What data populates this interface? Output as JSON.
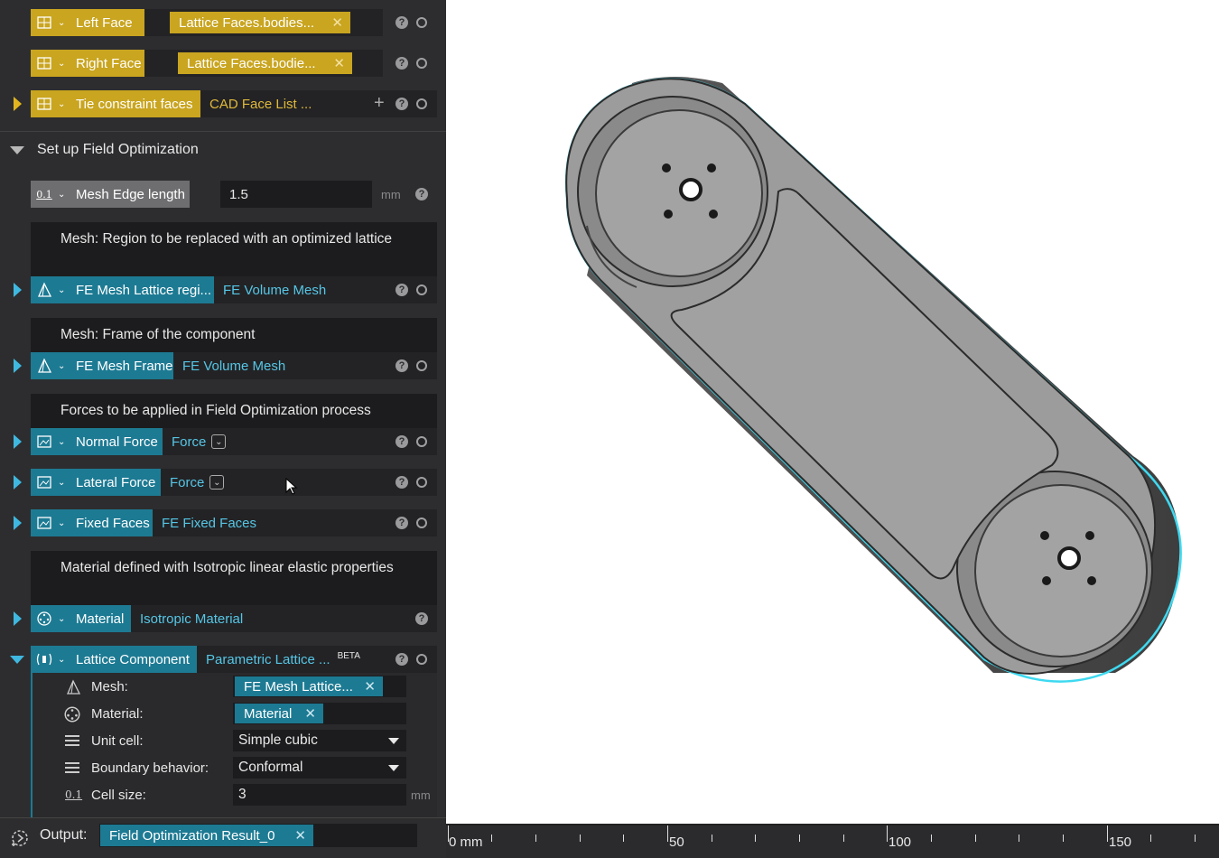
{
  "rows": {
    "left_face": {
      "label": "Left Face",
      "value": "Lattice Faces.bodies..."
    },
    "right_face": {
      "label": "Right Face",
      "value": "Lattice Faces.bodie..."
    },
    "tie": {
      "label": "Tie constraint faces",
      "value": "CAD Face List ..."
    }
  },
  "section": {
    "title": "Set up Field Optimization"
  },
  "mesh_edge": {
    "label": "Mesh Edge length",
    "value": "1.5",
    "unit": "mm",
    "icon_text": "0.1"
  },
  "comments": {
    "region": "Mesh: Region to be replaced with an optimized lattice",
    "frame": "Mesh: Frame of the component",
    "forces": "Forces to be applied in Field Optimization process",
    "material": "Material defined with Isotropic linear elastic properties"
  },
  "fe_lattice": {
    "label": "FE Mesh Lattice regi...",
    "value": "FE Volume Mesh"
  },
  "fe_frame": {
    "label": "FE Mesh Frame",
    "value": "FE Volume Mesh"
  },
  "normal_force": {
    "label": "Normal Force",
    "value": "Force"
  },
  "lateral_force": {
    "label": "Lateral Force",
    "value": "Force"
  },
  "fixed_faces": {
    "label": "Fixed Faces",
    "value": "FE Fixed Faces"
  },
  "material_row": {
    "label": "Material",
    "value": "Isotropic Material"
  },
  "lattice": {
    "label": "Lattice Component",
    "value": "Parametric Lattice ...",
    "badge": "BETA",
    "props": {
      "mesh_label": "Mesh:",
      "mesh_value": "FE Mesh Lattice...",
      "material_label": "Material:",
      "material_value": "Material",
      "unit_cell_label": "Unit cell:",
      "unit_cell_value": "Simple cubic",
      "boundary_label": "Boundary behavior:",
      "boundary_value": "Conformal",
      "cell_size_label": "Cell size:",
      "cell_size_value": "3",
      "cell_size_unit": "mm",
      "cell_size_icon_text": "0.1"
    }
  },
  "output": {
    "label": "Output:",
    "value": "Field Optimization Result_0"
  },
  "ruler": {
    "labels": [
      "0 mm",
      "50",
      "100",
      "150"
    ]
  },
  "colors": {
    "yellow": "#c9a520",
    "blue": "#1d7a93",
    "panel": "#2d2d2f",
    "highlight": "#3ed9f0"
  }
}
